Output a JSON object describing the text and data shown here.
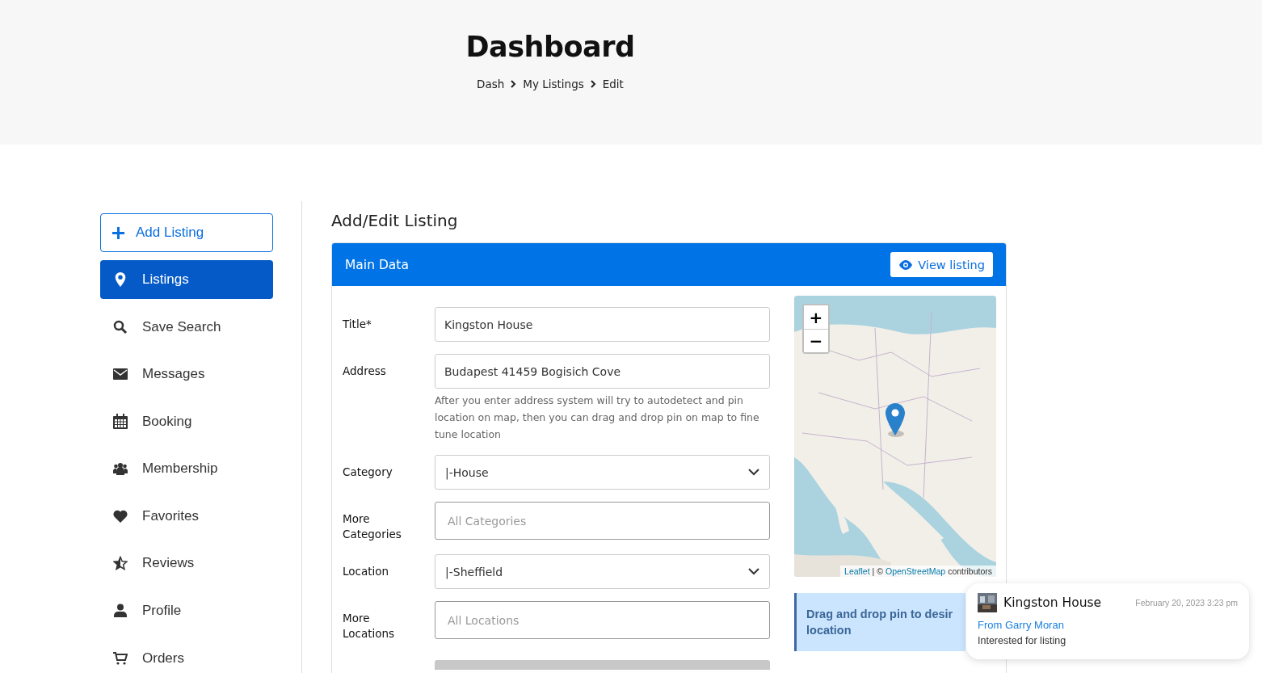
{
  "header": {
    "title": "Dashboard",
    "breadcrumb": [
      "Dash",
      "My Listings",
      "Edit"
    ]
  },
  "sidebar": {
    "add_button": "Add Listing",
    "items": [
      {
        "label": "Listings",
        "selected": true
      },
      {
        "label": "Save Search",
        "selected": false
      },
      {
        "label": "Messages",
        "selected": false
      },
      {
        "label": "Booking",
        "selected": false
      },
      {
        "label": "Membership",
        "selected": false
      },
      {
        "label": "Favorites",
        "selected": false
      },
      {
        "label": "Reviews",
        "selected": false
      },
      {
        "label": "Profile",
        "selected": false
      },
      {
        "label": "Orders",
        "selected": false
      }
    ]
  },
  "page_title": "Add/Edit Listing",
  "panel": {
    "title": "Main Data",
    "view_button": "View listing",
    "fields": [
      {
        "kind": "input",
        "label": "Title*",
        "value": "Kingston House"
      },
      {
        "kind": "input",
        "label": "Address",
        "value": "Budapest 41459 Bogisich Cove",
        "help": "After you enter address system will try to autodetect and pin location on map, then you can drag and drop pin on map to fine tune location"
      },
      {
        "kind": "select",
        "label": "Category",
        "value": "|-House"
      },
      {
        "kind": "multi",
        "label": "More Categories",
        "placeholder": "All Categories"
      },
      {
        "kind": "select",
        "label": "Location",
        "value": "|-Sheffield"
      },
      {
        "kind": "multi",
        "label": "More Locations",
        "placeholder": "All Locations"
      }
    ],
    "map": {
      "zoom_in": "+",
      "zoom_out": "−",
      "attribution_link": "Leaflet",
      "attribution_separator": "| ©",
      "attribution_source": "OpenStreetMap",
      "attribution_suffix": "contributors"
    },
    "hint_lines": [
      "Drag and drop pin to desir",
      "location"
    ]
  },
  "toast": {
    "title": "Kingston House",
    "date": "February 20, 2023 3:23 pm",
    "from": "From Garry Moran",
    "message": "Interested for listing"
  }
}
